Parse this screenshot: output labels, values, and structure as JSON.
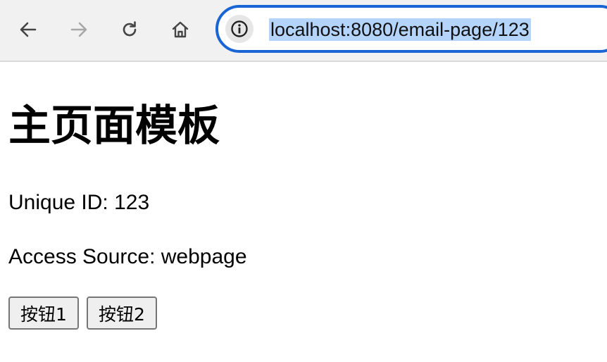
{
  "browser": {
    "url": "localhost:8080/email-page/123",
    "icons": {
      "back": "arrow-left-icon",
      "forward": "arrow-right-icon",
      "reload": "reload-icon",
      "home": "home-icon",
      "site_info": "info-icon"
    },
    "colors": {
      "focus_ring": "#1a65d6",
      "selection": "#b4d4fb"
    }
  },
  "page": {
    "title": "主页面模板",
    "unique_id_line": "Unique ID: 123",
    "access_source_line": "Access Source: webpage",
    "buttons": [
      {
        "label": "按钮1"
      },
      {
        "label": "按钮2"
      }
    ]
  }
}
